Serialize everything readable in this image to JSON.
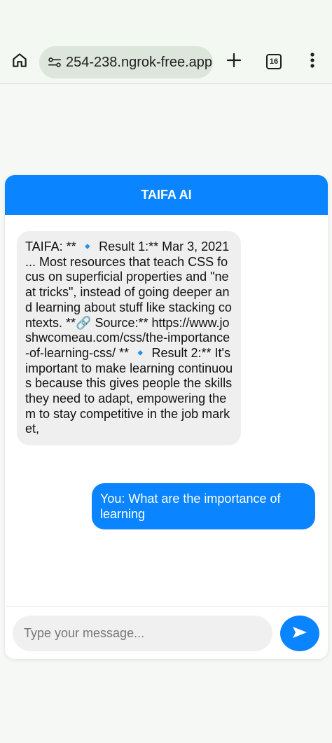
{
  "browser": {
    "url": "254-238.ngrok-free.app",
    "tab_count": "16",
    "icons": {
      "home": "home-icon",
      "site_info": "site-settings-icon",
      "new_tab": "plus-icon",
      "tabs": "tab-switcher-icon",
      "menu": "more-vert-icon"
    }
  },
  "chat": {
    "title": "TAIFA AI",
    "messages": [
      {
        "sender": "bot",
        "text": "TAIFA: ** 🔹 Result 1:** Mar 3, 2021 ... Most resources that teach CSS focus on superficial properties and \"neat tricks\", instead of going deeper and learning about stuff like stacking contexts. **🔗 Source:** https://www.joshwcomeau.com/css/the-importance-of-learning-css/ ** 🔹 Result 2:** It's important to make learning continuous because this gives people the skills they need to adapt, empowering them to stay competitive in the job market,"
      },
      {
        "sender": "user",
        "text": "You: What are the importance of learning"
      }
    ],
    "input": {
      "placeholder": "Type your message...",
      "value": ""
    },
    "send_icon": "send-icon"
  },
  "colors": {
    "accent": "#0a84ff",
    "bot_bubble": "#efefef",
    "browser_bar": "#f3f8f2",
    "url_pill": "#dde6da"
  }
}
